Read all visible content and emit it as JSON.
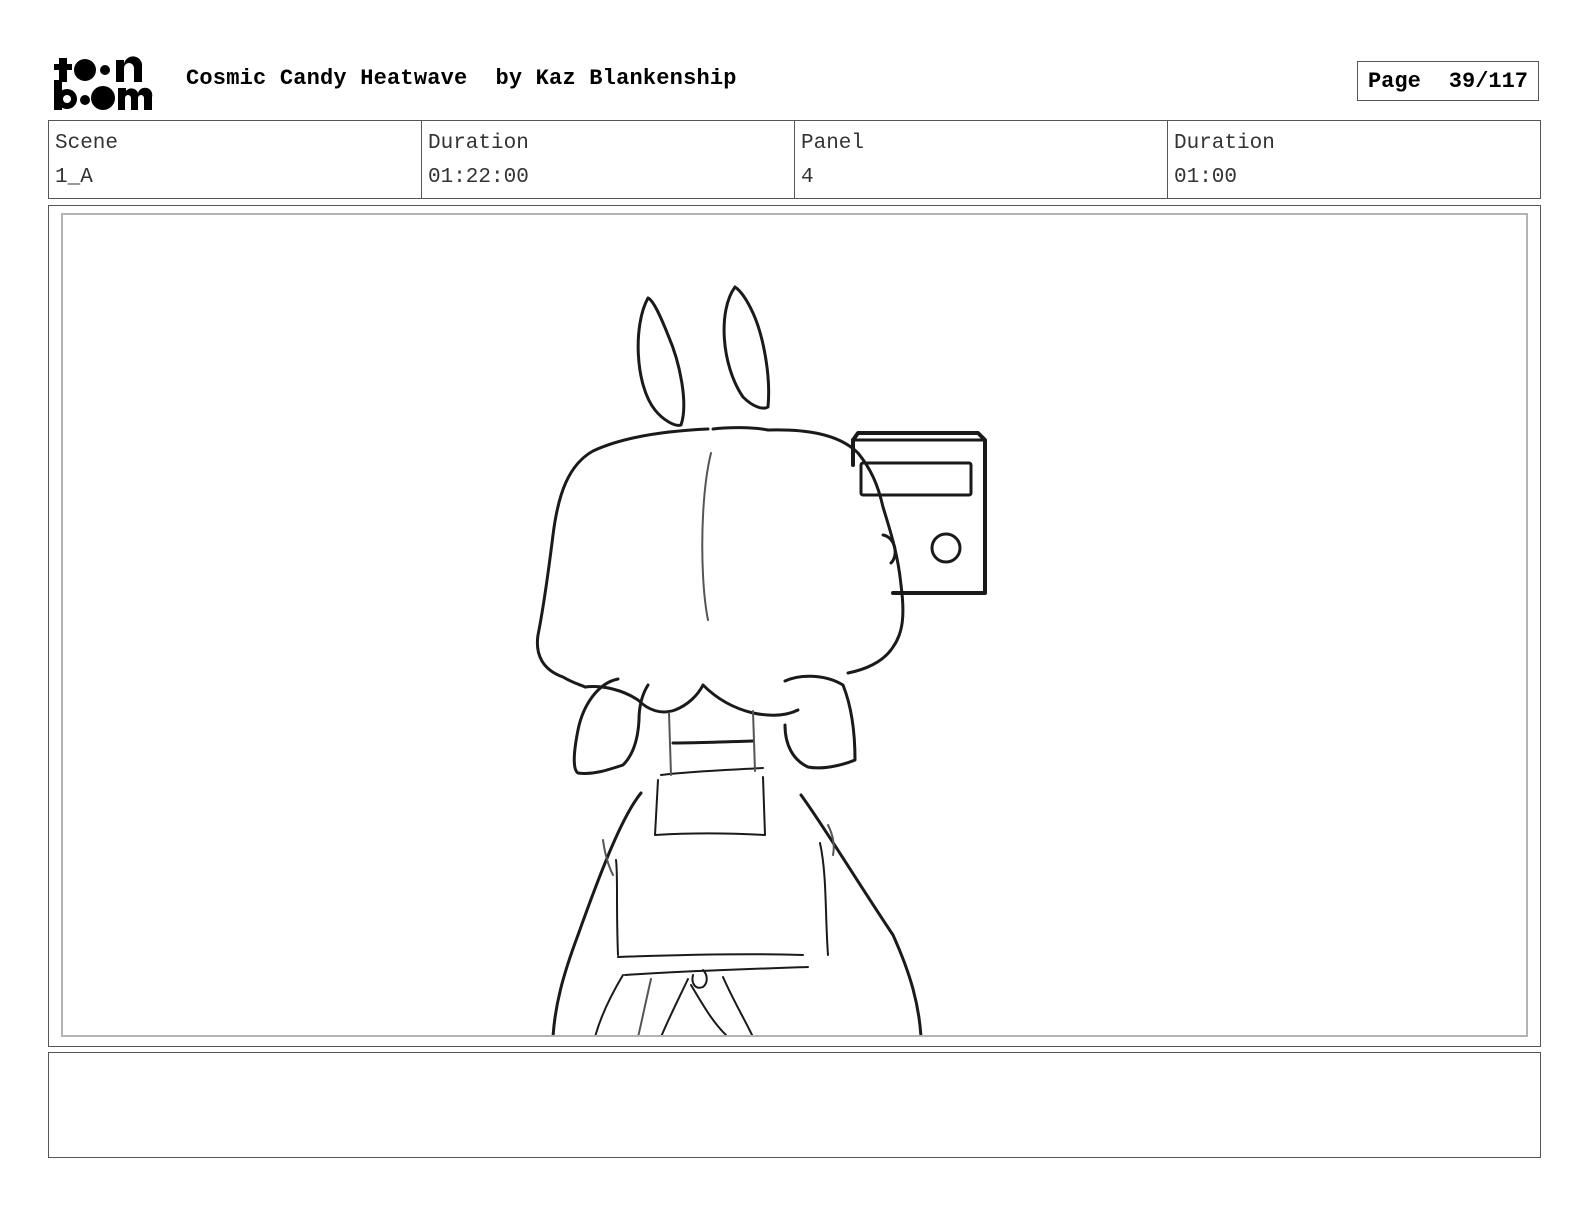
{
  "header": {
    "logo_text": "toon boom",
    "project_title": "Cosmic Candy Heatwave",
    "author_line": "by Kaz Blankenship",
    "page_label": "Page",
    "page_value": "39/117"
  },
  "info": {
    "scene_label": "Scene",
    "scene_value": "1_A",
    "scene_duration_label": "Duration",
    "scene_duration_value": "01:22:00",
    "panel_label": "Panel",
    "panel_value": "4",
    "panel_duration_label": "Duration",
    "panel_duration_value": "01:00"
  },
  "notes": {
    "text": ""
  }
}
